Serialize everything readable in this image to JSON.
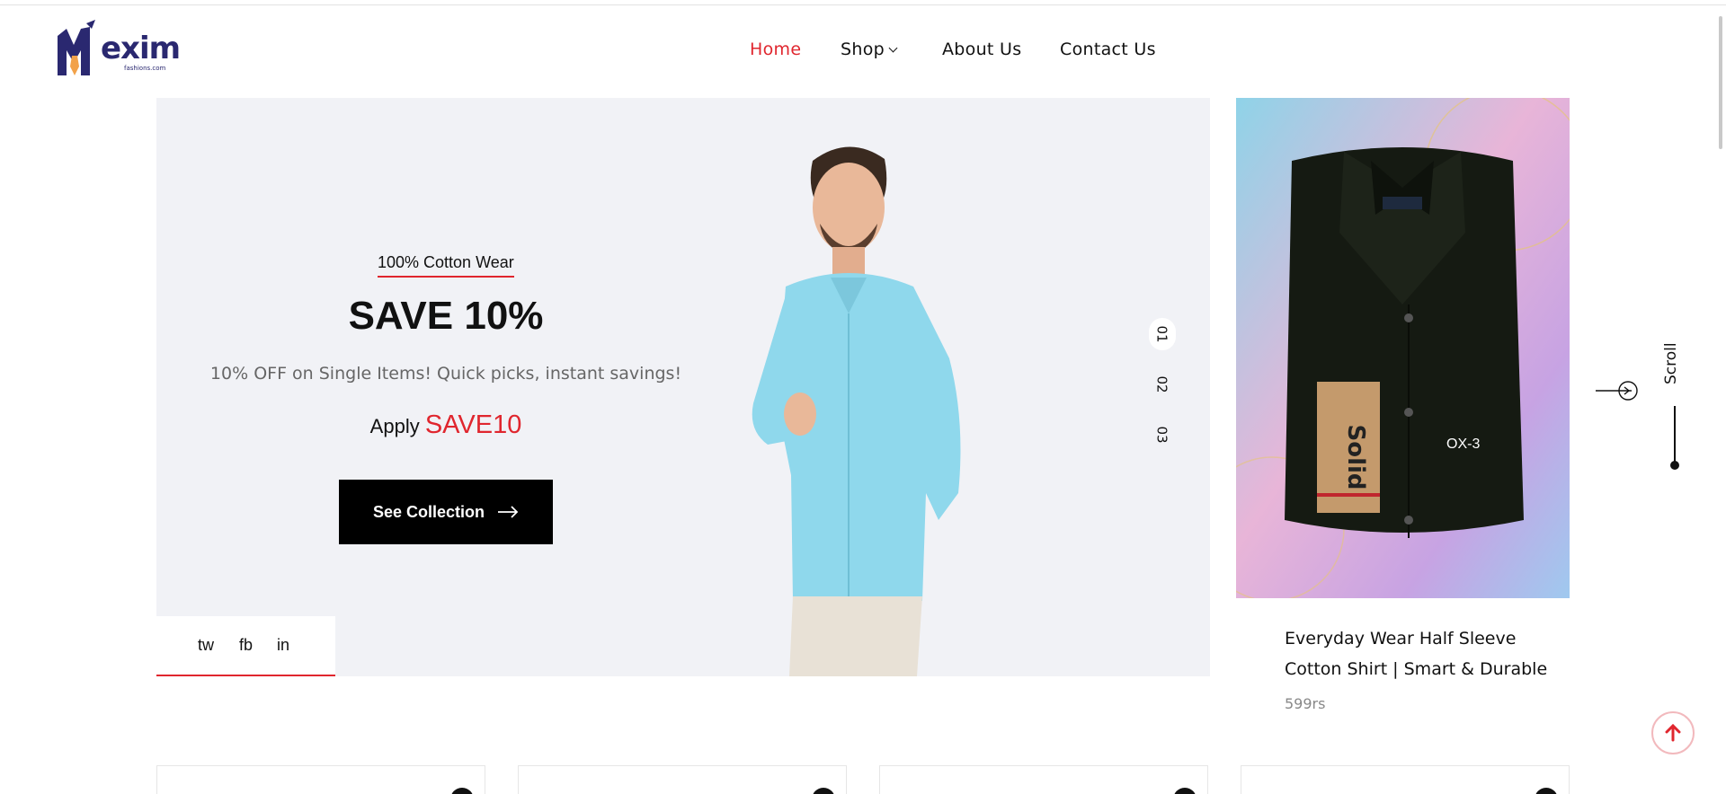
{
  "brand": {
    "name": "exim",
    "domain": "fashions.com"
  },
  "nav": {
    "items": [
      {
        "label": "Home",
        "active": true
      },
      {
        "label": "Shop",
        "has_dropdown": true
      },
      {
        "label": "About Us"
      },
      {
        "label": "Contact Us"
      }
    ]
  },
  "hero": {
    "tag": "100% Cotton Wear",
    "title": "SAVE 10%",
    "description": "10% OFF on Single Items! Quick picks, instant savings!",
    "apply_prefix": "Apply",
    "promo_code": "SAVE10",
    "cta_label": "See Collection",
    "social": [
      "tw",
      "fb",
      "in"
    ],
    "slides": [
      "01",
      "02",
      "03"
    ],
    "active_slide": 0
  },
  "product": {
    "image_label": "OX-3",
    "title": "Everyday Wear Half Sleeve Cotton Shirt | Smart & Durable",
    "price": "599rs"
  },
  "side": {
    "scroll_label": "Scroll"
  },
  "colors": {
    "accent": "#e0262e",
    "brand_navy": "#2a2870",
    "hero_bg": "#f1f2f6",
    "button_bg": "#000000"
  },
  "icons": [
    "logo-mark",
    "chevron-down-icon",
    "arrow-right-icon",
    "circle-arrow-right-icon",
    "arrow-up-icon"
  ]
}
